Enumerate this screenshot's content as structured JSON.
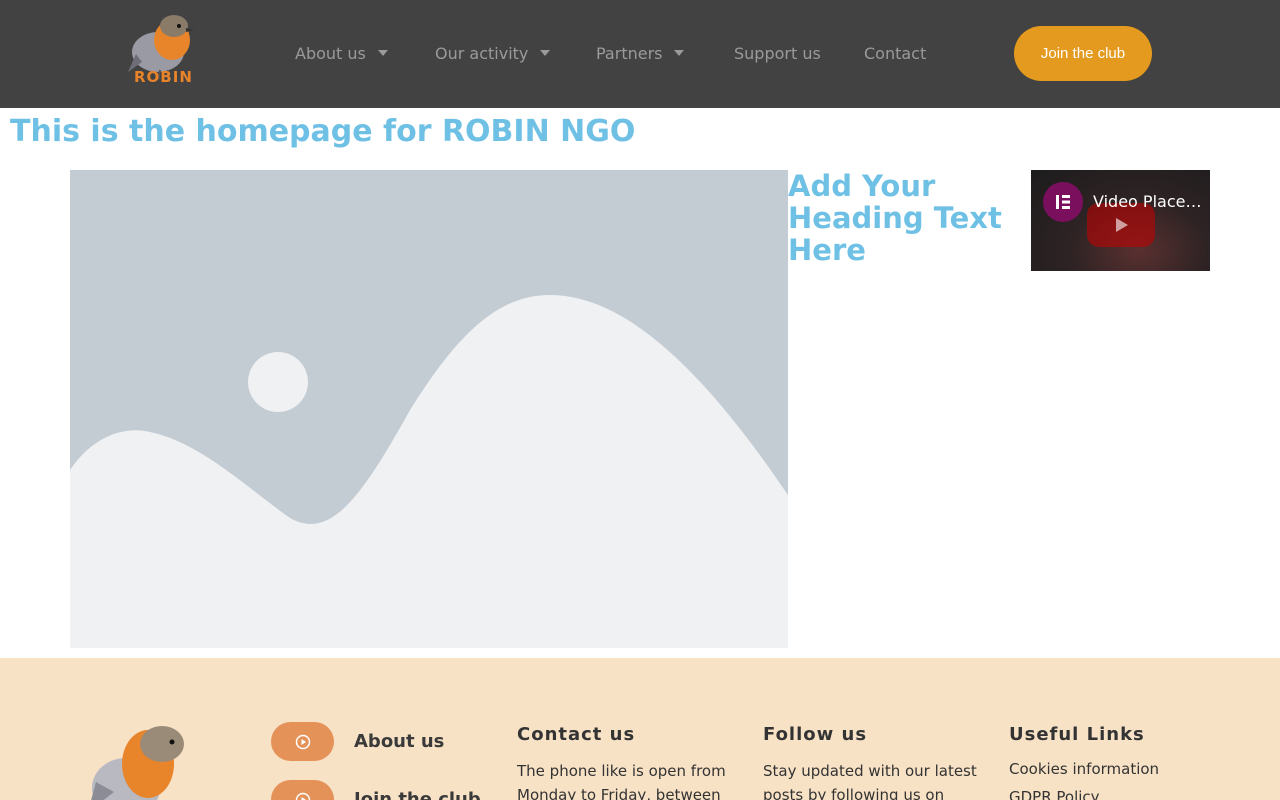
{
  "header": {
    "logo_text": "ROBIN",
    "nav": [
      {
        "label": "About us",
        "has_dropdown": true
      },
      {
        "label": "Our activity",
        "has_dropdown": true
      },
      {
        "label": "Partners",
        "has_dropdown": true
      },
      {
        "label": "Support us",
        "has_dropdown": false
      },
      {
        "label": "Contact",
        "has_dropdown": false
      }
    ],
    "cta_label": "Join the club"
  },
  "main": {
    "page_title": "This is the homepage for ROBIN NGO",
    "side_heading": "Add Your Heading Text Here",
    "video_title": "Video Placeholder"
  },
  "footer": {
    "links": [
      {
        "label": "About us"
      },
      {
        "label": "Join the club"
      }
    ],
    "contact": {
      "title": "Contact us",
      "text": "The phone like is open from Monday to Friday, between"
    },
    "follow": {
      "title": "Follow us",
      "text": "Stay updated with our latest posts by following us on"
    },
    "useful": {
      "title": "Useful Links",
      "items": [
        "Cookies information",
        "GDPR Policy"
      ]
    }
  },
  "colors": {
    "header_bg": "#424242",
    "accent": "#e49a1e",
    "heading": "#6ec1e4",
    "footer_bg": "#f8e2c6"
  }
}
